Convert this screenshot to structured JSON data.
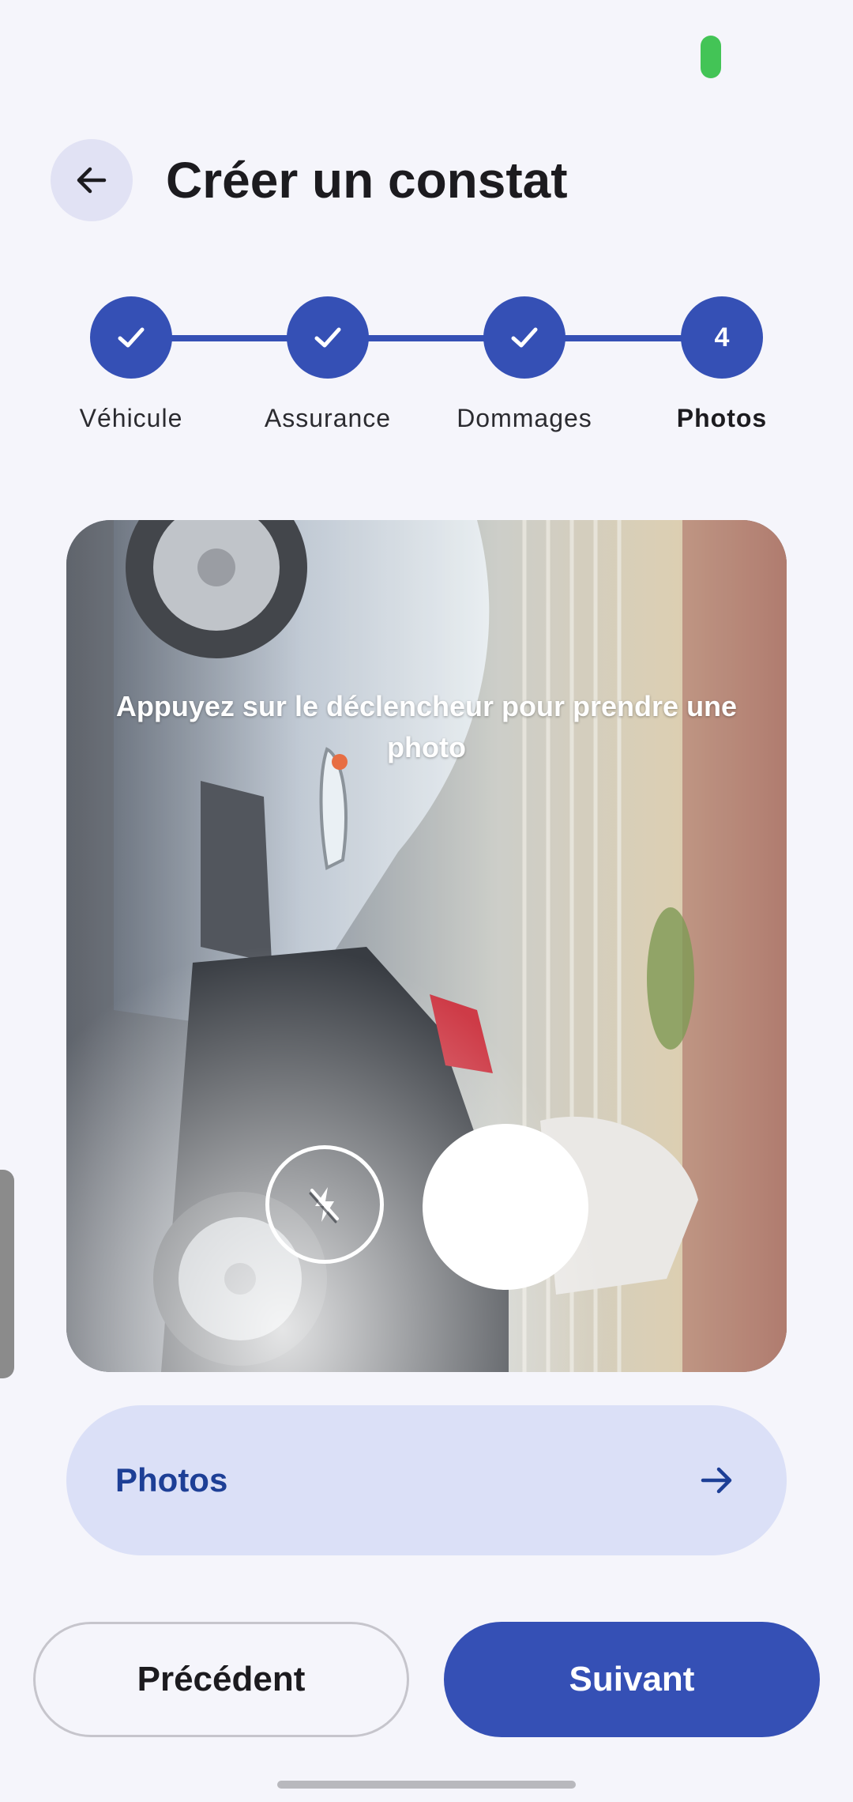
{
  "header": {
    "title": "Créer un constat",
    "back_icon": "arrow-left-icon"
  },
  "stepper": {
    "steps": [
      {
        "label": "Véhicule",
        "state": "done",
        "icon": "check-icon"
      },
      {
        "label": "Assurance",
        "state": "done",
        "icon": "check-icon"
      },
      {
        "label": "Dommages",
        "state": "done",
        "icon": "check-icon"
      },
      {
        "label": "Photos",
        "state": "active",
        "number": "4"
      }
    ]
  },
  "camera": {
    "hint": "Appuyez sur le déclencheur pour prendre une photo",
    "flash_icon": "flash-off-icon",
    "shutter": "shutter-button"
  },
  "photos_row": {
    "label": "Photos",
    "icon": "arrow-right-icon"
  },
  "footer": {
    "prev_label": "Précédent",
    "next_label": "Suivant"
  },
  "colors": {
    "primary": "#3550b5",
    "background": "#f5f5fb",
    "tonal": "#dbe0f7",
    "status_green": "#43c456"
  }
}
